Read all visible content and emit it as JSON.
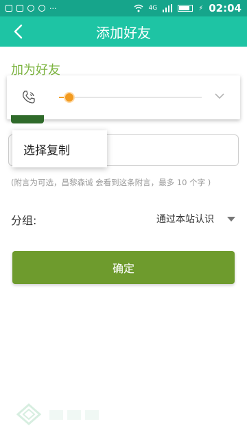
{
  "status_bar": {
    "time": "02:04",
    "network": "4G",
    "icons": [
      "image-icon",
      "grid-icon",
      "chat-icon",
      "chat-icon",
      "more-icon",
      "wifi-icon",
      "signal-icon",
      "battery-icon",
      "charging-icon"
    ]
  },
  "titlebar": {
    "title": "添加好友",
    "back_icon": "chevron-left-icon"
  },
  "section": {
    "title": "加为好友"
  },
  "floating_call": {
    "phone_icon": "phone-icon",
    "slider_progress": 0.07,
    "chevron_icon": "chevron-down-icon"
  },
  "message": {
    "value": "",
    "placeholder": ""
  },
  "context_menu": {
    "items": [
      {
        "label": "选择复制"
      }
    ]
  },
  "hint": "(附言为可选，昌黎森诚 会看到这条附言，最多 10 个字 )",
  "group": {
    "label": "分组:",
    "value": "通过本站认识"
  },
  "confirm_button": {
    "label": "确定"
  },
  "colors": {
    "status_bar": "#16a58b",
    "titlebar": "#1ec4a4",
    "accent_green": "#7ab33c",
    "button_green": "#6e9b2d",
    "slider_orange": "#f29a1f"
  }
}
